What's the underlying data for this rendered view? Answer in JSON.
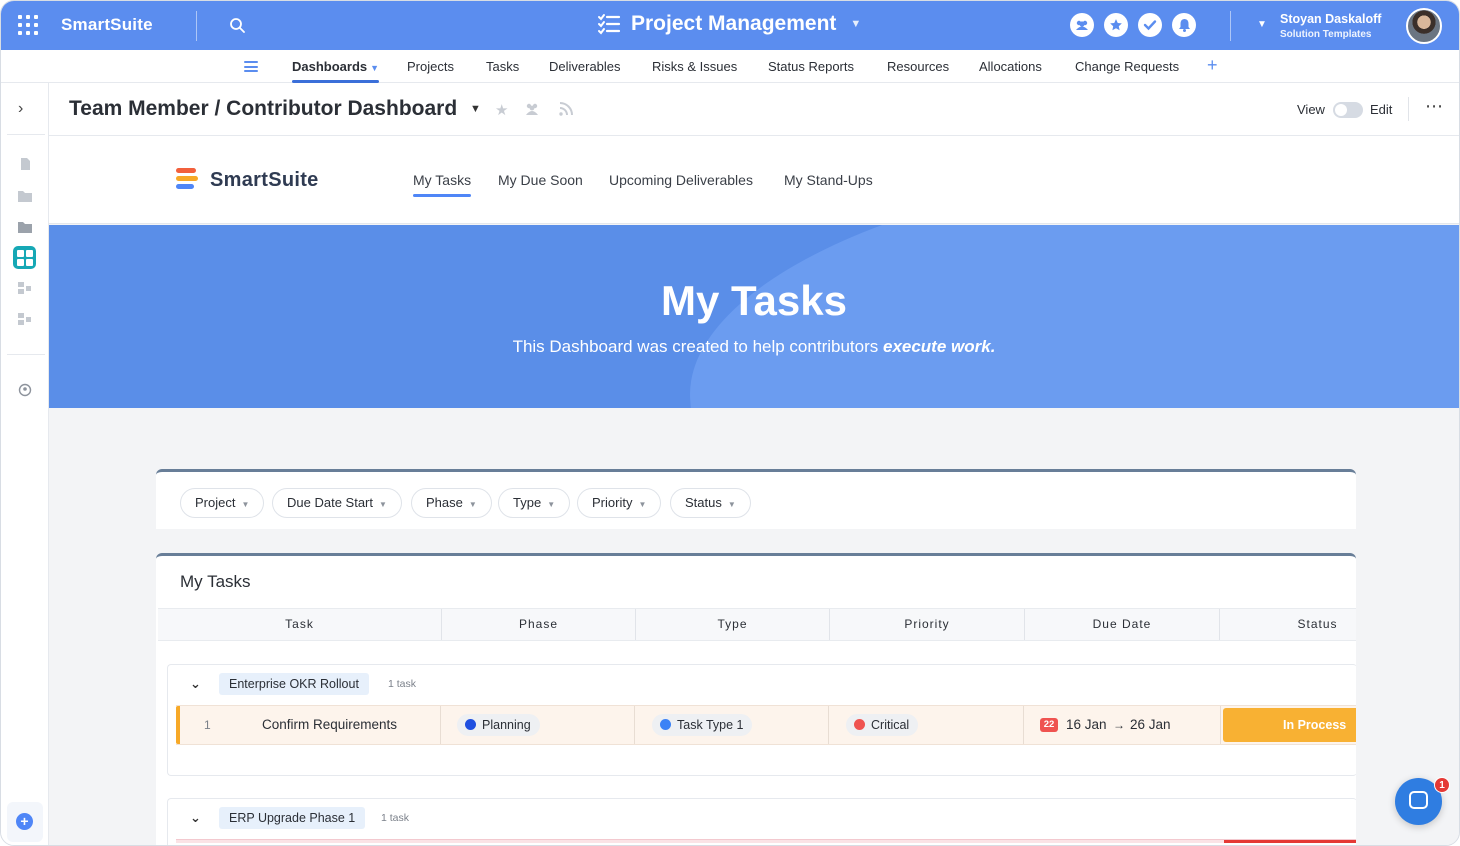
{
  "topbar": {
    "brand": "SmartSuite",
    "app_title": "Project Management",
    "user_name": "Stoyan Daskaloff",
    "user_subtitle": "Solution Templates"
  },
  "nav": {
    "items": [
      {
        "label": "Dashboards",
        "active": true
      },
      {
        "label": "Projects"
      },
      {
        "label": "Tasks"
      },
      {
        "label": "Deliverables"
      },
      {
        "label": "Risks & Issues"
      },
      {
        "label": "Status Reports"
      },
      {
        "label": "Resources"
      },
      {
        "label": "Allocations"
      },
      {
        "label": "Change Requests"
      }
    ],
    "add_label": "+"
  },
  "dashboard": {
    "title": "Team Member / Contributor Dashboard",
    "view_label": "View",
    "edit_label": "Edit",
    "more_label": "⋯"
  },
  "site": {
    "logo_text": "SmartSuite",
    "tabs": [
      "My Tasks",
      "My Due Soon",
      "Upcoming Deliverables",
      "My Stand-Ups"
    ],
    "active_tab": "My Tasks"
  },
  "hero": {
    "title": "My Tasks",
    "subtitle_plain": "This Dashboard was created to help contributors ",
    "subtitle_emphasis": "execute work."
  },
  "filters": [
    "Project",
    "Due Date Start",
    "Phase",
    "Type",
    "Priority",
    "Status"
  ],
  "tasks_widget": {
    "title": "My Tasks",
    "columns": [
      "Task",
      "Phase",
      "Type",
      "Priority",
      "Due Date",
      "Status"
    ],
    "groups": [
      {
        "name": "Enterprise OKR Rollout",
        "count": "1 task",
        "rows": [
          {
            "num": "1",
            "task": "Confirm Requirements",
            "phase": "Planning",
            "type": "Task Type 1",
            "priority": "Critical",
            "due_badge": "22",
            "due_start": "16 Jan",
            "due_arrow": "→",
            "due_end": "26 Jan",
            "status": "In Process"
          }
        ]
      },
      {
        "name": "ERP Upgrade Phase 1",
        "count": "1 task",
        "rows": []
      }
    ]
  },
  "colors": {
    "topbar": "#5b8def",
    "hero": "#5a8ee8",
    "phase_dot": "#1f4fe0",
    "type_dot": "#3b82f6",
    "priority_dot": "#ef5350",
    "status_in_process": "#f8b133"
  },
  "chat": {
    "badge": "1"
  },
  "icons": [
    "apps-grid-icon",
    "search-icon",
    "checklist-icon",
    "team-icon",
    "star-icon",
    "check-icon",
    "bell-icon",
    "chevron-right-icon",
    "document-icon",
    "folder-icon",
    "dashboard-icon",
    "intercom-chat-icon"
  ]
}
